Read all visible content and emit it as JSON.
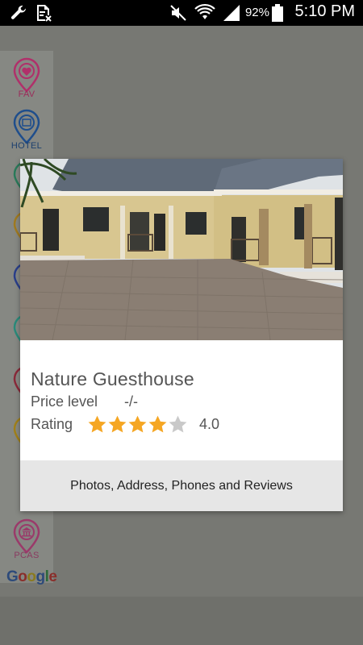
{
  "status_bar": {
    "battery_percent": "92%",
    "time": "5:10 PM",
    "icons": [
      "wrench-icon",
      "sim-error-icon",
      "mute-icon",
      "wifi-icon",
      "signal-icon",
      "battery-icon"
    ]
  },
  "sidebar": {
    "items": [
      {
        "label": "FAV",
        "icon": "heart-pin-icon",
        "color": "#c2185b"
      },
      {
        "label": "HOTEL",
        "icon": "hotel-pin-icon",
        "color": "#1f4e8c"
      },
      {
        "label": "PCAS",
        "icon": "bank-pin-icon",
        "color": "#b0306a"
      }
    ],
    "google_logo": "Google"
  },
  "dialog": {
    "title": "Nature Guesthouse",
    "price_label": "Price level",
    "price_value": "-/-",
    "rating_label": "Rating",
    "rating_value": "4.0",
    "rating_stars": 4,
    "rating_max": 5,
    "footer_button": "Photos, Address, Phones and Reviews",
    "star_color": "#f5a623",
    "star_empty_color": "#c9c9c9"
  }
}
